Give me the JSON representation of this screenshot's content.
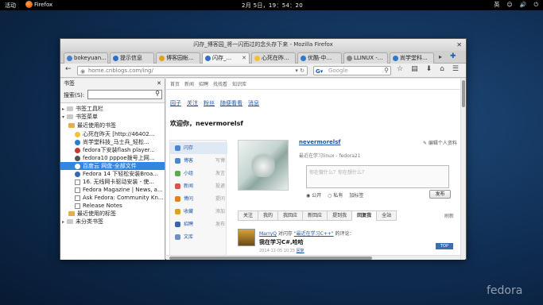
{
  "topbar": {
    "activities": "活动",
    "app": "Firefox",
    "clock": "2月 5日，19：54：20",
    "lang": "英",
    "tray_icons": [
      "accessibility-icon",
      "volume-icon",
      "power-icon"
    ]
  },
  "window": {
    "title": "闪存_博客园_将一闪而过的念头存下来 - Mozilla Firefox",
    "tabs": [
      {
        "label": "bokeyuan..."
      },
      {
        "label": "提示信息"
      },
      {
        "label": "博客园帐..."
      },
      {
        "label": "闪存_..."
      },
      {
        "label": "心死在昨..."
      },
      {
        "label": "优酷-中..."
      },
      {
        "label": "LLINUX -..."
      },
      {
        "label": "尚学堂科..."
      }
    ],
    "url": "home.cnblogs.com/ing/",
    "search_placeholder": "Google"
  },
  "sidebar": {
    "title": "书签",
    "search_label": "搜索(S):",
    "items": [
      {
        "label": "书签工具栏"
      },
      {
        "label": "书签菜单"
      },
      {
        "label": "最近使用的书签"
      },
      {
        "label": "心死在昨天 [http://46402..."
      },
      {
        "label": "尚学堂科技_马士兵_轻松..."
      },
      {
        "label": "fedora下安装flash player..."
      },
      {
        "label": "fedora10 pppoe拨号上网..."
      },
      {
        "label": "百度云 网盘-全部文件"
      },
      {
        "label": "Fedora 14 下轻松安装Broa..."
      },
      {
        "label": "16. 无线网卡驱动安装 - 使..."
      },
      {
        "label": "Fedora Magazine | News, a..."
      },
      {
        "label": "Ask Fedora: Community Kn..."
      },
      {
        "label": "Release Notes"
      },
      {
        "label": "最近使用的标签"
      },
      {
        "label": "未分类书签"
      }
    ]
  },
  "page": {
    "toplinks": [
      "首页",
      "新闻",
      "招聘",
      "找找看",
      "知识库"
    ],
    "subnav": [
      "园子",
      "关注",
      "粉丝",
      "随便看看",
      "消息"
    ],
    "welcome": "欢迎你，nevermorelsf",
    "menu": [
      {
        "label": "闪存",
        "right": ""
      },
      {
        "label": "博客",
        "right": "写博"
      },
      {
        "label": "小组",
        "right": "发言"
      },
      {
        "label": "新闻",
        "right": "投递"
      },
      {
        "label": "博问",
        "right": "提问"
      },
      {
        "label": "收藏",
        "right": "添加"
      },
      {
        "label": "招聘",
        "right": "发布"
      },
      {
        "label": "文库",
        "right": ""
      }
    ],
    "username": "nevermorelsf",
    "edit_profile": "✎ 编辑个人资料",
    "status": "最近在学习linux - fedora21",
    "post_placeholder": "你在做什么？你在想什么？",
    "radio_public": "公开",
    "radio_private": "私有",
    "tag_label": "加标签",
    "publish": "发布",
    "tabs": [
      "关注",
      "我的",
      "我回应",
      "新回应",
      "提到我",
      "回复我",
      "全站"
    ],
    "active_tab_index": 5,
    "refresh": "刷新",
    "feed": {
      "user": "MarryQ",
      "action": "对闪存",
      "quote": "\"最近在学习C++\"",
      "suffix": "的评论：",
      "text": "我在学习C#,哈哈",
      "time": "2014-12-05 10:25",
      "reply": "回复",
      "to_top": "TOP"
    }
  },
  "desktop": {
    "brand": "fedora"
  }
}
